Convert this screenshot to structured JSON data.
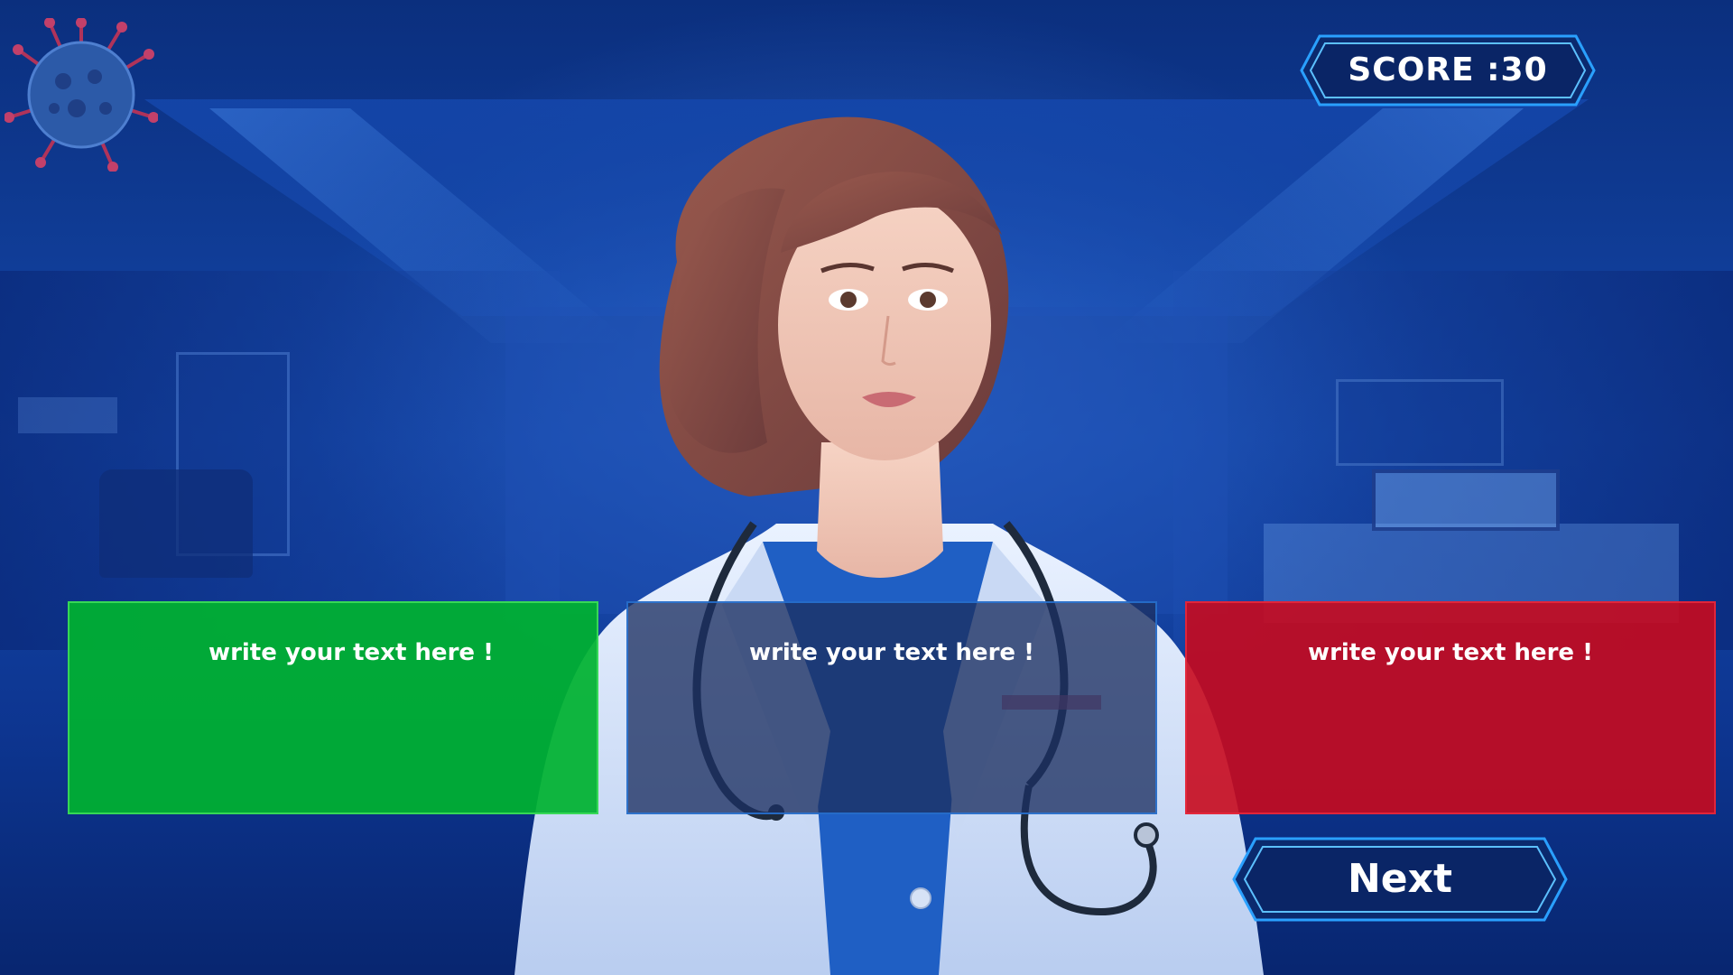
{
  "hud": {
    "score_text": "SCORE :30"
  },
  "answers": [
    {
      "label": "write your text here !",
      "status": "correct",
      "color": "#00b230"
    },
    {
      "label": "write your text here !",
      "status": "neutral",
      "color": "#1c3062"
    },
    {
      "label": "write your text here !",
      "status": "wrong",
      "color": "#c80a1e"
    }
  ],
  "controls": {
    "next_label": "Next"
  },
  "scene": {
    "character": "doctor-character",
    "background": "hospital-room",
    "decoration": "virus-icon",
    "accent_color": "#2aa0ff"
  }
}
